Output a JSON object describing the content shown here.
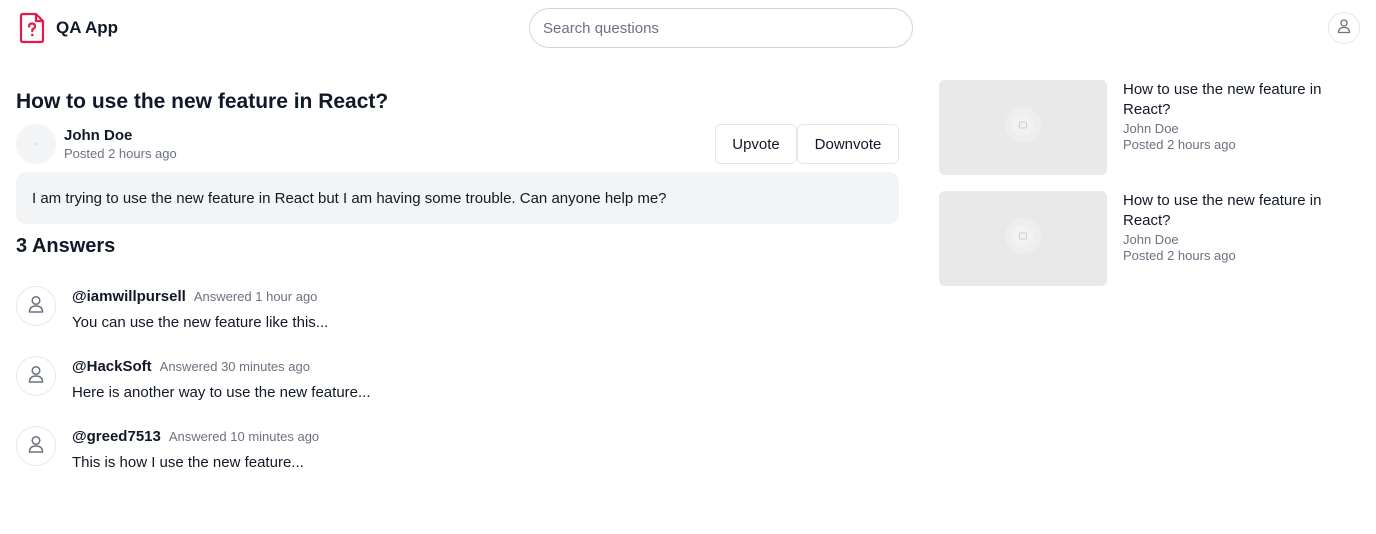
{
  "app": {
    "name": "QA App",
    "logo_icon": "question-document-icon",
    "accent_color": "#e11d48"
  },
  "header": {
    "search_placeholder": "Search questions",
    "user_icon": "user-icon"
  },
  "question": {
    "title": "How to use the new feature in React?",
    "author": "John Doe",
    "posted": "Posted 2 hours ago",
    "body": "I am trying to use the new feature in React but I am having some trouble. Can anyone help me?",
    "upvote_label": "Upvote",
    "downvote_label": "Downvote"
  },
  "answers": {
    "heading": "3 Answers",
    "items": [
      {
        "handle": "@iamwillpursell",
        "meta": "Answered 1 hour ago",
        "text": "You can use the new feature like this..."
      },
      {
        "handle": "@HackSoft",
        "meta": "Answered 30 minutes ago",
        "text": "Here is another way to use the new feature..."
      },
      {
        "handle": "@greed7513",
        "meta": "Answered 10 minutes ago",
        "text": "This is how I use the new feature..."
      }
    ]
  },
  "related": [
    {
      "title": "How to use the new feature in React?",
      "author": "John Doe",
      "posted": "Posted 2 hours ago"
    },
    {
      "title": "How to use the new feature in React?",
      "author": "John Doe",
      "posted": "Posted 2 hours ago"
    }
  ]
}
